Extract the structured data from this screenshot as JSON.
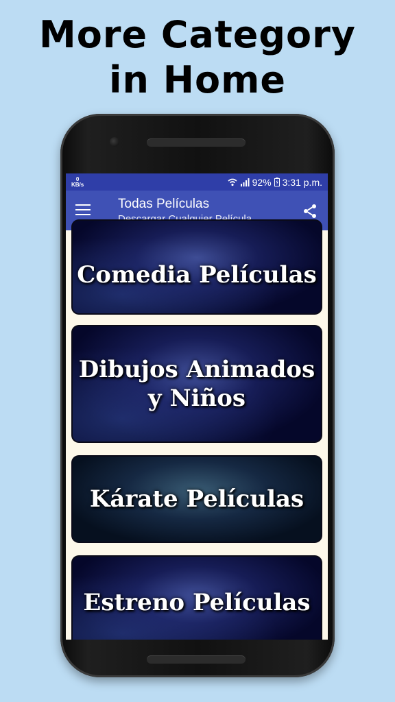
{
  "promo": {
    "line1": "More Category",
    "line2": "in Home"
  },
  "statusbar": {
    "speed_value": "0",
    "speed_unit": "KB/s",
    "battery": "92%",
    "time": "3:31 p.m."
  },
  "appbar": {
    "title": "Todas Películas",
    "subtitle": "Descargar Cualquier Película"
  },
  "categories": [
    {
      "label": "Comedia Películas"
    },
    {
      "label_line1": "Dibujos Animados",
      "label_line2": "y Niños"
    },
    {
      "label": "Kárate Películas"
    },
    {
      "label": "Estreno Películas"
    }
  ],
  "icons": [
    "menu-icon",
    "share-icon",
    "wifi-icon",
    "signal-icon",
    "battery-icon"
  ]
}
